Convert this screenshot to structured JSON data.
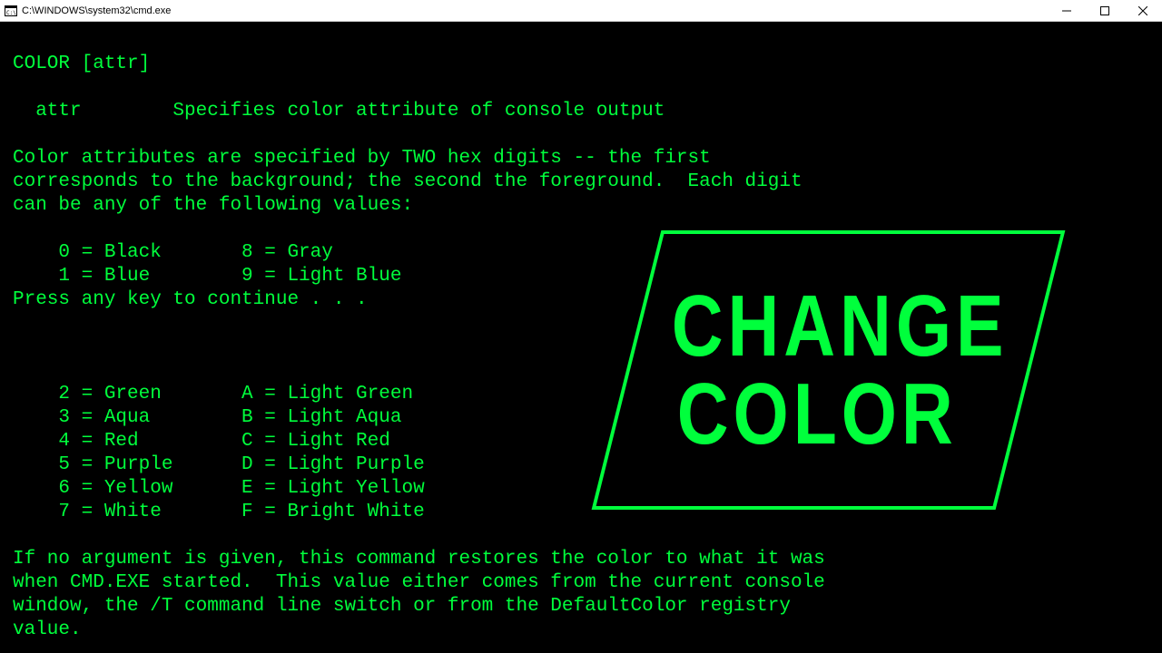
{
  "window": {
    "title": "C:\\WINDOWS\\system32\\cmd.exe"
  },
  "colors": {
    "term_fg": "#00ff3c",
    "term_bg": "#000000"
  },
  "terminal": {
    "lines": [
      "",
      "COLOR [attr]",
      "",
      "  attr        Specifies color attribute of console output",
      "",
      "Color attributes are specified by TWO hex digits -- the first",
      "corresponds to the background; the second the foreground.  Each digit",
      "can be any of the following values:",
      "",
      "    0 = Black       8 = Gray",
      "    1 = Blue        9 = Light Blue",
      "Press any key to continue . . .",
      "",
      "",
      "",
      "    2 = Green       A = Light Green",
      "    3 = Aqua        B = Light Aqua",
      "    4 = Red         C = Light Red",
      "    5 = Purple      D = Light Purple",
      "    6 = Yellow      E = Light Yellow",
      "    7 = White       F = Bright White",
      "",
      "If no argument is given, this command restores the color to what it was",
      "when CMD.EXE started.  This value either comes from the current console",
      "window, the /T command line switch or from the DefaultColor registry",
      "value."
    ]
  },
  "overlay": {
    "line1": "CHANGE",
    "line2": "COLOR"
  }
}
